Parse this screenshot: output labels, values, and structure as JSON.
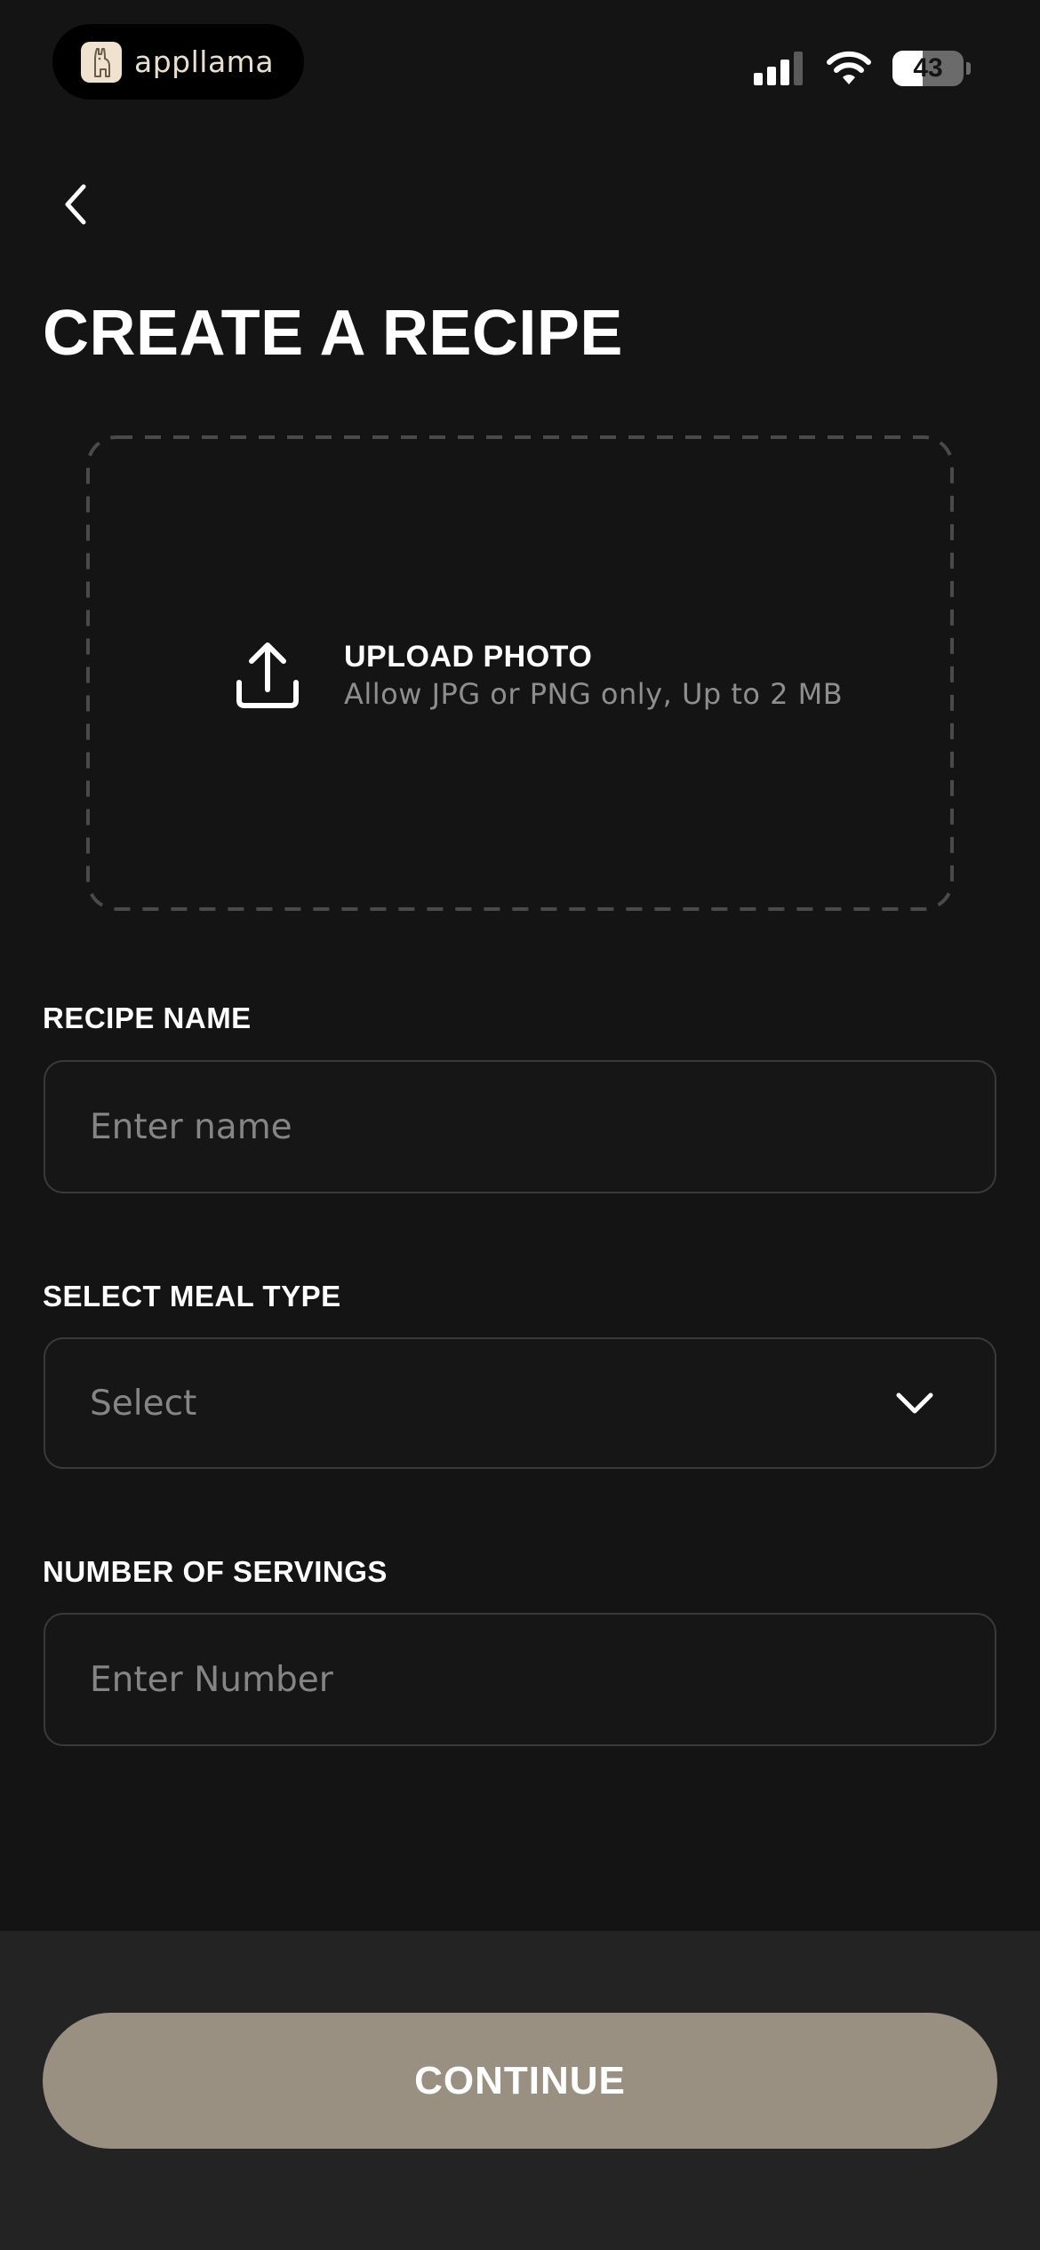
{
  "status_bar": {
    "app_name": "appllama",
    "battery_level": "43",
    "battery_fraction": 0.43,
    "icons": [
      "cellular-signal-icon",
      "wifi-icon",
      "battery-icon"
    ]
  },
  "nav": {
    "back_icon": "chevron-left-icon"
  },
  "page": {
    "title": "CREATE A RECIPE"
  },
  "upload": {
    "icon": "upload-icon",
    "title": "UPLOAD PHOTO",
    "hint": "Allow JPG or PNG only, Up to 2 MB"
  },
  "form": {
    "recipe_name": {
      "label": "RECIPE NAME",
      "placeholder": "Enter name",
      "value": ""
    },
    "meal_type": {
      "label": "SELECT MEAL TYPE",
      "selected": "Select",
      "icon": "chevron-down-icon"
    },
    "servings": {
      "label": "NUMBER OF SERVINGS",
      "placeholder": "Enter Number",
      "value": ""
    }
  },
  "footer": {
    "continue_label": "CONTINUE"
  },
  "colors": {
    "background": "#141414",
    "footer_background": "#232323",
    "accent": "#9a9082",
    "field_border": "#3a3a3a",
    "muted_text": "#858585"
  }
}
